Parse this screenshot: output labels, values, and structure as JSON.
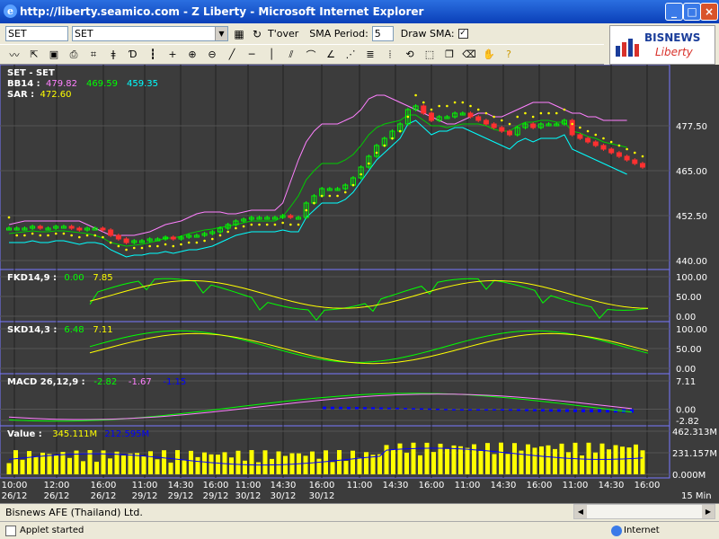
{
  "window": {
    "title": "http://liberty.seamico.com - Z Liberty - Microsoft Internet Explorer"
  },
  "toolbar": {
    "symbol_input": "SET",
    "symbol_select": "SET",
    "tover_label": "T'over",
    "sma_period_label": "SMA Period:",
    "sma_period_value": "5",
    "draw_sma_label": "Draw SMA:",
    "draw_sma_checked": "✓"
  },
  "logo": {
    "line1": "BISNEWS",
    "line2": "Liberty"
  },
  "statusbar": {
    "company": "Bisnews AFE (Thailand) Ltd.",
    "applet": "Applet started",
    "zone": "Internet"
  },
  "chart_data": [
    {
      "type": "candlestick",
      "title": "SET - SET",
      "legend": [
        {
          "label": "BB14 :",
          "values": [
            "479.82",
            "469.59",
            "459.35"
          ],
          "colors": [
            "#ff80ff",
            "#00ff00",
            "#00ffff"
          ]
        },
        {
          "label": "SAR :",
          "values": [
            "472.60"
          ],
          "colors": [
            "#ffff00"
          ]
        }
      ],
      "y_ticks": [
        "477.50",
        "465.00",
        "452.50",
        "440.00"
      ],
      "ylim": [
        438,
        488
      ],
      "close": [
        449,
        449,
        449,
        449.5,
        449,
        449,
        449.5,
        449.5,
        449,
        448.5,
        449,
        449,
        448.5,
        447,
        446,
        445,
        445.5,
        445.5,
        446,
        446,
        446.5,
        446,
        446.5,
        447,
        447,
        447.5,
        448,
        449,
        450,
        451,
        451.5,
        452,
        452,
        452,
        452,
        452.5,
        452,
        452,
        456,
        458,
        460,
        460,
        460,
        461,
        463,
        466,
        469,
        472,
        474,
        476,
        478,
        482,
        483,
        481,
        479,
        480,
        480,
        481,
        481,
        480,
        479,
        478,
        477,
        476,
        475,
        477,
        478,
        477,
        478,
        478,
        478,
        479,
        475,
        474,
        473,
        472,
        471,
        470,
        469,
        468,
        467,
        466
      ],
      "upper": [
        450,
        450.5,
        451,
        451,
        451,
        451,
        451,
        451,
        451,
        451,
        450,
        449,
        448,
        447,
        447,
        447,
        447,
        447.5,
        448,
        449,
        450,
        450.5,
        451,
        452,
        453,
        453.5,
        453.5,
        453.5,
        453,
        453,
        453.5,
        454,
        454,
        454,
        454,
        456,
        462,
        468,
        473,
        476,
        478,
        478,
        478,
        479,
        480,
        482,
        485,
        486,
        486,
        485,
        484,
        483,
        482,
        481,
        480,
        479,
        478,
        478,
        479,
        480,
        481,
        481,
        480,
        480,
        481,
        482,
        483,
        484,
        484,
        484,
        483,
        482,
        481,
        481,
        480,
        480,
        479,
        479,
        479,
        479
      ]
    },
    {
      "type": "line",
      "title": "FKD14,9 :",
      "legend_values": [
        "0.00",
        "7.85"
      ],
      "legend_colors": [
        "#00ff00",
        "#ffff00"
      ],
      "y_ticks": [
        "100.00",
        "50.00",
        "0.00"
      ],
      "ylim": [
        0,
        100
      ]
    },
    {
      "type": "line",
      "title": "SKD14,3 :",
      "legend_values": [
        "6.48",
        "7.11"
      ],
      "legend_colors": [
        "#00ff00",
        "#ffff00"
      ],
      "y_ticks": [
        "100.00",
        "50.00",
        "0.00"
      ],
      "ylim": [
        0,
        100
      ]
    },
    {
      "type": "line",
      "title": "MACD 26,12,9 :",
      "legend_values": [
        "-2.82",
        "-1.67",
        "-1.15"
      ],
      "legend_colors": [
        "#00ff00",
        "#ff80ff",
        "#0000ff"
      ],
      "y_ticks": [
        "7.11",
        "0.00",
        "-2.82"
      ],
      "ylim": [
        -2.82,
        7.11
      ]
    },
    {
      "type": "bar",
      "title": "Value :",
      "legend_values": [
        "345.111M",
        "212.595M"
      ],
      "legend_colors": [
        "#ffff00",
        "#0000ff"
      ],
      "y_ticks": [
        "462.313M",
        "231.157M",
        "0.000M"
      ],
      "ylim": [
        0,
        462.313
      ]
    }
  ],
  "x_axis": {
    "times": [
      "10:00",
      "12:00",
      "16:00",
      "11:00",
      "14:30",
      "16:00",
      "11:00",
      "14:30",
      "16:00",
      "11:00",
      "14:30",
      "16:00",
      "11:00",
      "14:30",
      "16:00",
      "11:00",
      "14:30",
      "16:00"
    ],
    "dates": [
      "26/12",
      "26/12",
      "26/12",
      "29/12",
      "29/12",
      "29/12",
      "30/12",
      "30/12",
      "30/12",
      "",
      "",
      "",
      "",
      "",
      "",
      "",
      "",
      ""
    ],
    "interval": "15 Min"
  }
}
